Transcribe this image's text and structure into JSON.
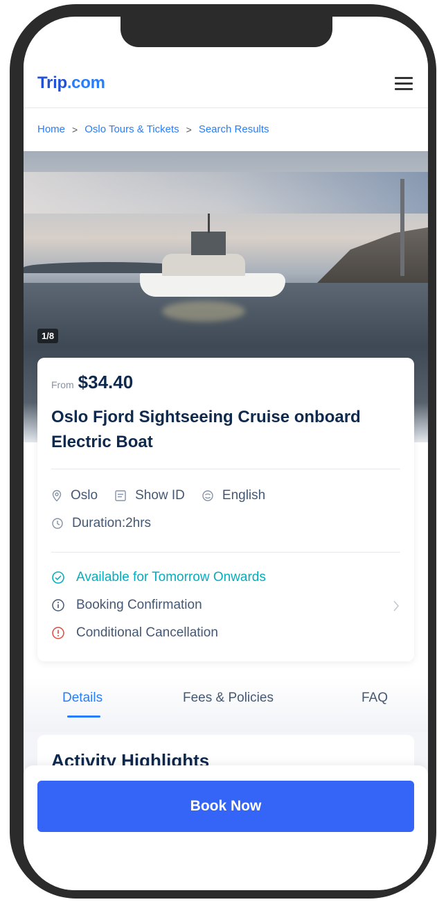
{
  "header": {
    "logo_part1": "Trip",
    "logo_part2": ".com",
    "menu_icon": "hamburger-menu-icon"
  },
  "breadcrumb": {
    "items": [
      "Home",
      "Oslo Tours & Tickets",
      "Search Results"
    ],
    "separator": ">"
  },
  "gallery": {
    "counter": "1/8"
  },
  "product": {
    "price_prefix": "From",
    "price": "$34.40",
    "title": "Oslo Fjord Sightseeing Cruise onboard Electric Boat",
    "meta": [
      {
        "icon": "location-pin-icon",
        "label": "Oslo"
      },
      {
        "icon": "id-card-icon",
        "label": "Show ID"
      },
      {
        "icon": "language-icon",
        "label": "English"
      }
    ],
    "duration": {
      "icon": "clock-icon",
      "label": "Duration:2hrs"
    },
    "features": [
      {
        "icon": "check-circle-icon",
        "label": "Available for Tomorrow Onwards",
        "color": "#06aebd"
      },
      {
        "icon": "info-circle-icon",
        "label": "Booking Confirmation",
        "color": "#455873"
      },
      {
        "icon": "alert-circle-icon",
        "label": "Conditional Cancellation",
        "color": "#e0483b"
      }
    ]
  },
  "tabs": {
    "items": [
      "Details",
      "Fees & Policies",
      "FAQ"
    ],
    "active": "Details"
  },
  "highlights": {
    "title": "Activity Highlights"
  },
  "footer": {
    "book_label": "Book Now"
  },
  "colors": {
    "accent": "#287dfa",
    "button": "#3565f6",
    "title": "#0f294d",
    "available": "#06aebd",
    "warning": "#e0483b"
  }
}
